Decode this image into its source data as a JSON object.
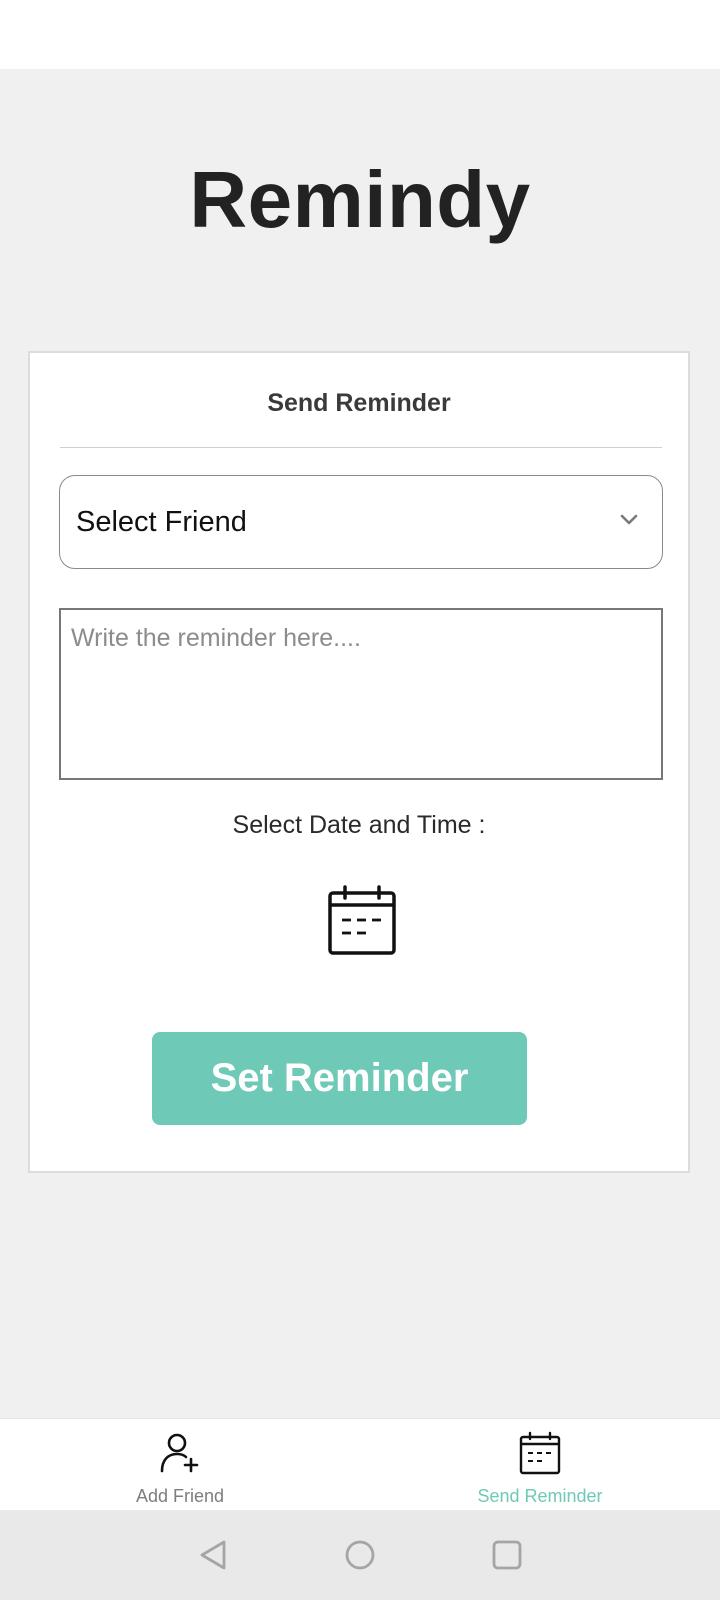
{
  "app": {
    "title": "Remindy"
  },
  "card": {
    "title": "Send Reminder",
    "friend_select": {
      "selected": "Select Friend",
      "icon": "chevron-down-icon"
    },
    "reminder_input": {
      "value": "",
      "placeholder": "Write the reminder here...."
    },
    "date_label": "Select Date and Time :",
    "calendar_icon": "calendar-icon",
    "submit_label": "Set Reminder"
  },
  "bottom_nav": {
    "items": [
      {
        "label": "Add Friend",
        "icon": "add-user-icon",
        "active": false
      },
      {
        "label": "Send Reminder",
        "icon": "calendar-icon",
        "active": true
      }
    ]
  },
  "system_nav": {
    "buttons": [
      "back-icon",
      "home-icon",
      "recents-icon"
    ]
  },
  "colors": {
    "accent": "#6ec9b6",
    "background": "#f0f0f0",
    "title_text": "#222222",
    "inactive_nav": "#7d7d7d"
  }
}
